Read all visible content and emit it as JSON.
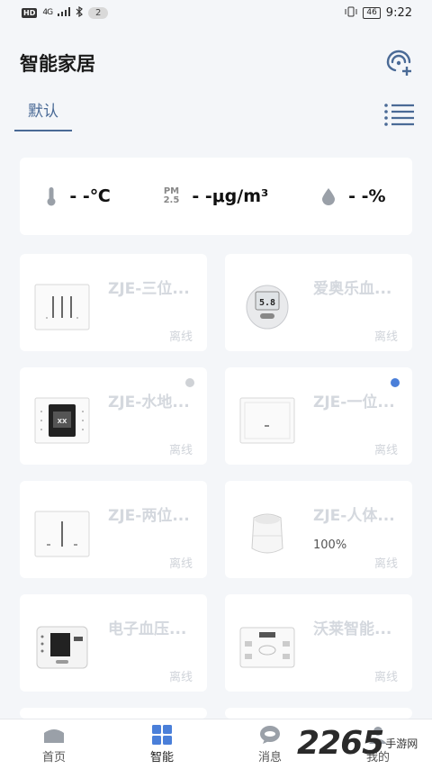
{
  "status_bar": {
    "hd": "HD",
    "network": "4G",
    "notification_count": "2",
    "battery": "46",
    "time": "9:22"
  },
  "header": {
    "title": "智能家居"
  },
  "tabs": {
    "default_label": "默认"
  },
  "environment": {
    "temperature": "- -℃",
    "pm_label_top": "PM",
    "pm_label_bottom": "2.5",
    "pm25": "- -μg/m³",
    "humidity": "- -%"
  },
  "devices": [
    {
      "name": "ZJE-三位...",
      "status": "离线",
      "image": "triple-switch-icon"
    },
    {
      "name": "爱奥乐血...",
      "status": "离线",
      "image": "glucose-meter-icon",
      "screen_value": "5.8"
    },
    {
      "name": "ZJE-水地...",
      "status": "离线",
      "image": "floor-heating-panel-icon",
      "dot_color": "#cfd2d6",
      "panel_text": "XX"
    },
    {
      "name": "ZJE-一位...",
      "status": "离线",
      "image": "single-switch-icon",
      "dot_color": "#4a7fd9"
    },
    {
      "name": "ZJE-两位...",
      "status": "离线",
      "image": "double-switch-icon"
    },
    {
      "name": "ZJE-人体...",
      "status": "离线",
      "image": "motion-sensor-icon",
      "extra": "100%"
    },
    {
      "name": "电子血压...",
      "status": "离线",
      "image": "blood-pressure-monitor-icon"
    },
    {
      "name": "沃莱智能...",
      "status": "离线",
      "image": "body-scale-icon"
    }
  ],
  "bottom_nav": [
    {
      "label": "首页",
      "icon": "home-icon"
    },
    {
      "label": "智能",
      "icon": "grid-icon",
      "active": true
    },
    {
      "label": "消息",
      "icon": "message-icon"
    },
    {
      "label": "我的",
      "icon": "profile-icon"
    }
  ],
  "watermark": {
    "number": "2265",
    "text": "手游网"
  },
  "colors": {
    "accent": "#4a6a96",
    "background": "#f4f6f9",
    "card": "#ffffff",
    "offline_text": "#d0d4da"
  }
}
